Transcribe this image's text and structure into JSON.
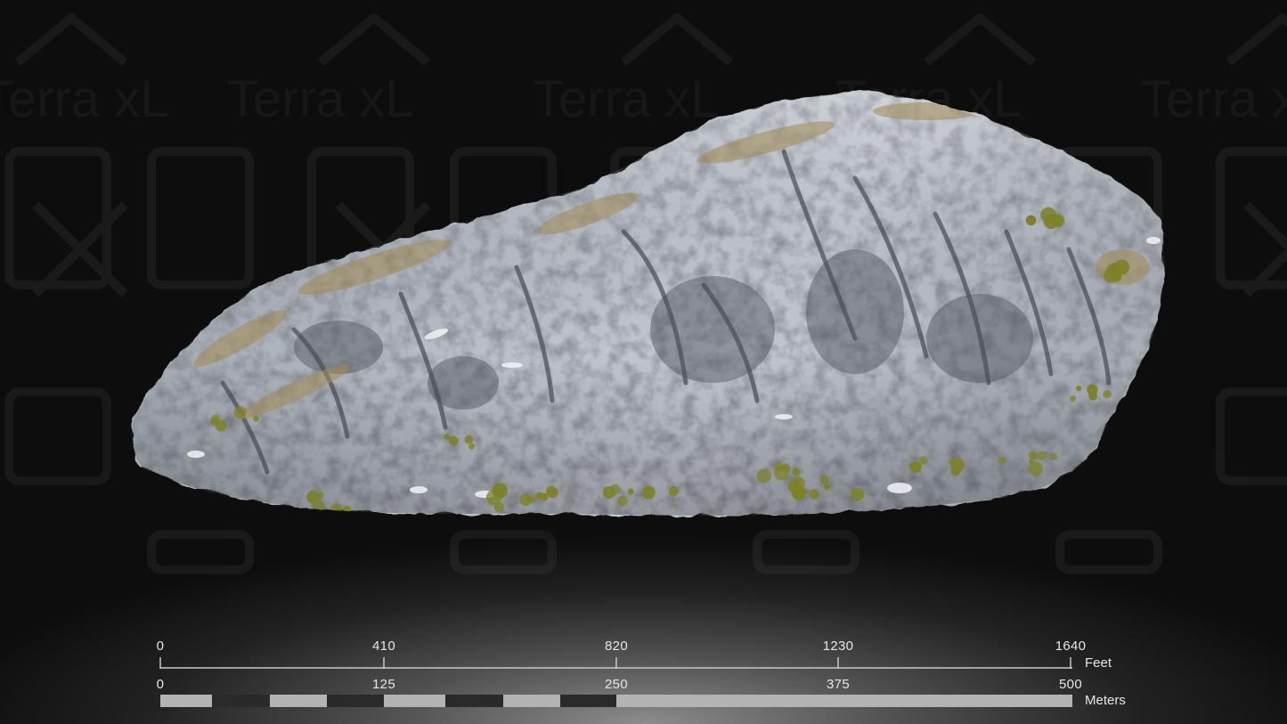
{
  "watermark": {
    "text": "Terra xL"
  },
  "scale_bar": {
    "feet": {
      "ticks": [
        "0",
        "410",
        "820",
        "1230",
        "1640"
      ],
      "unit": "Feet"
    },
    "meters": {
      "ticks": [
        "0",
        "125",
        "250",
        "375",
        "500"
      ],
      "unit": "Meters"
    }
  },
  "colors": {
    "background": "#0d0d0d",
    "rock_light": "#c9ced6",
    "rock_mid": "#8d939b",
    "rock_dark": "#4b5058",
    "vegetation": "#8a8a2a",
    "grass_brown": "#a08a55",
    "scale_light": "#b3b3b3",
    "scale_dark": "#2a2a2a"
  }
}
